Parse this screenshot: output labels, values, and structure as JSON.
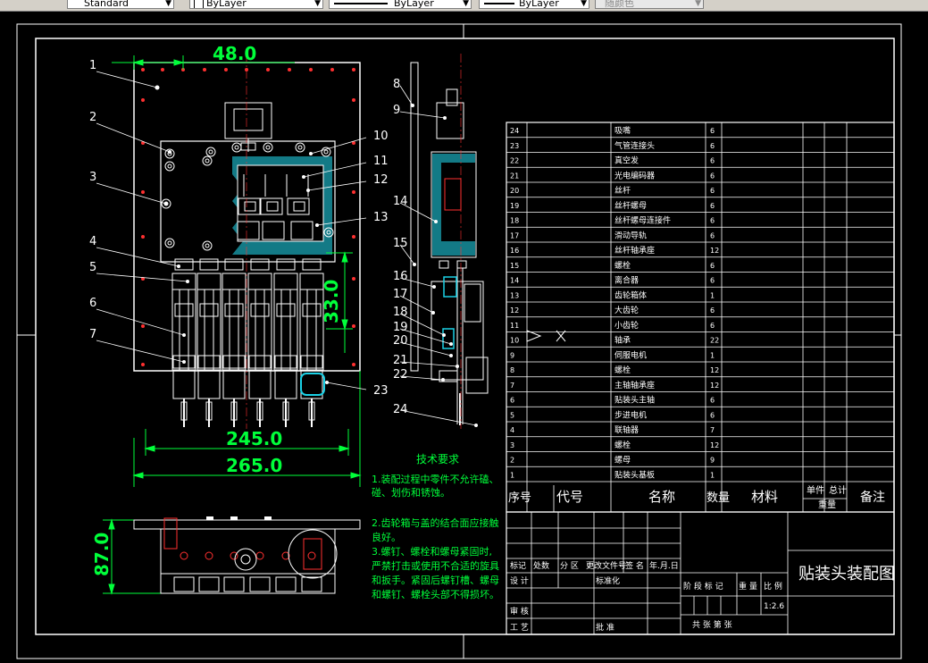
{
  "toolbar": {
    "text_style": "Standard",
    "layer": "ByLayer",
    "linetype": "ByLayer",
    "lineweight": "ByLayer",
    "plot_style": "随颜色"
  },
  "dims": {
    "top_width": "48.0",
    "inner_width": "245.0",
    "outer_width": "265.0",
    "vertical": "33.0",
    "bottom_height": "87.0"
  },
  "front_leaders": [
    "1",
    "2",
    "3",
    "4",
    "5",
    "6",
    "7"
  ],
  "side_leaders": [
    "8",
    "9",
    "10",
    "11",
    "12",
    "13",
    "14",
    "15",
    "16",
    "17",
    "18",
    "19",
    "20",
    "21",
    "22",
    "23",
    "24"
  ],
  "tech_req": {
    "title": "技术要求",
    "lines": [
      "1.装配过程中零件不允许磕、",
      "碰、划伤和锈蚀。",
      "",
      "2.齿轮箱与盖的结合面应接触",
      "良好。",
      "3.螺钉、螺栓和螺母紧固时,",
      "严禁打击或使用不合适的旋具",
      "和扳手。紧固后螺钉槽、螺母",
      "和螺钉、螺栓头部不得损坏。"
    ]
  },
  "bom": {
    "header": {
      "seq": "序号",
      "code": "代号",
      "name": "名称",
      "qty": "数量",
      "material": "材料",
      "unit": "单件",
      "total": "总计",
      "weight": "重量",
      "remark": "备注"
    },
    "rows": [
      {
        "no": "24",
        "name": "吸嘴",
        "qty": "6"
      },
      {
        "no": "23",
        "name": "气管连接头",
        "qty": "6"
      },
      {
        "no": "22",
        "name": "真空发",
        "qty": "6"
      },
      {
        "no": "21",
        "name": "光电编码器",
        "qty": "6"
      },
      {
        "no": "20",
        "name": "丝杆",
        "qty": "6"
      },
      {
        "no": "19",
        "name": "丝杆螺母",
        "qty": "6"
      },
      {
        "no": "18",
        "name": "丝杆螺母连接件",
        "qty": "6"
      },
      {
        "no": "17",
        "name": "滑动导轨",
        "qty": "6"
      },
      {
        "no": "16",
        "name": "丝杆轴承座",
        "qty": "12"
      },
      {
        "no": "15",
        "name": "螺栓",
        "qty": "6"
      },
      {
        "no": "14",
        "name": "离合器",
        "qty": "6"
      },
      {
        "no": "13",
        "name": "齿轮箱体",
        "qty": "1"
      },
      {
        "no": "12",
        "name": "大齿轮",
        "qty": "6"
      },
      {
        "no": "11",
        "name": "小齿轮",
        "qty": "6"
      },
      {
        "no": "10",
        "name": "轴承",
        "qty": "22"
      },
      {
        "no": "9",
        "name": "伺服电机",
        "qty": "1"
      },
      {
        "no": "8",
        "name": "螺栓",
        "qty": "12"
      },
      {
        "no": "7",
        "name": "主轴轴承座",
        "qty": "12"
      },
      {
        "no": "6",
        "name": "贴装头主轴",
        "qty": "6"
      },
      {
        "no": "5",
        "name": "步进电机",
        "qty": "6"
      },
      {
        "no": "4",
        "name": "联轴器",
        "qty": "7"
      },
      {
        "no": "3",
        "name": "螺栓",
        "qty": "12"
      },
      {
        "no": "2",
        "name": "螺母",
        "qty": "9"
      },
      {
        "no": "1",
        "name": "贴装头基板",
        "qty": "1"
      }
    ]
  },
  "title_block": {
    "title": "贴装头装配图",
    "mark": "标记",
    "count": "处数",
    "zone": "分 区",
    "change_doc": "更改文件号",
    "signature": "签 名",
    "date": "年.月.日",
    "design": "设 计",
    "standardize": "标准化",
    "stage_mark": "阶 段 标 记",
    "weight": "重 量",
    "scale": "比 例",
    "scale_value": "1:2.6",
    "review": "审 核",
    "process": "工 艺",
    "approve": "批 准",
    "sheets": "共    张    第    张"
  }
}
